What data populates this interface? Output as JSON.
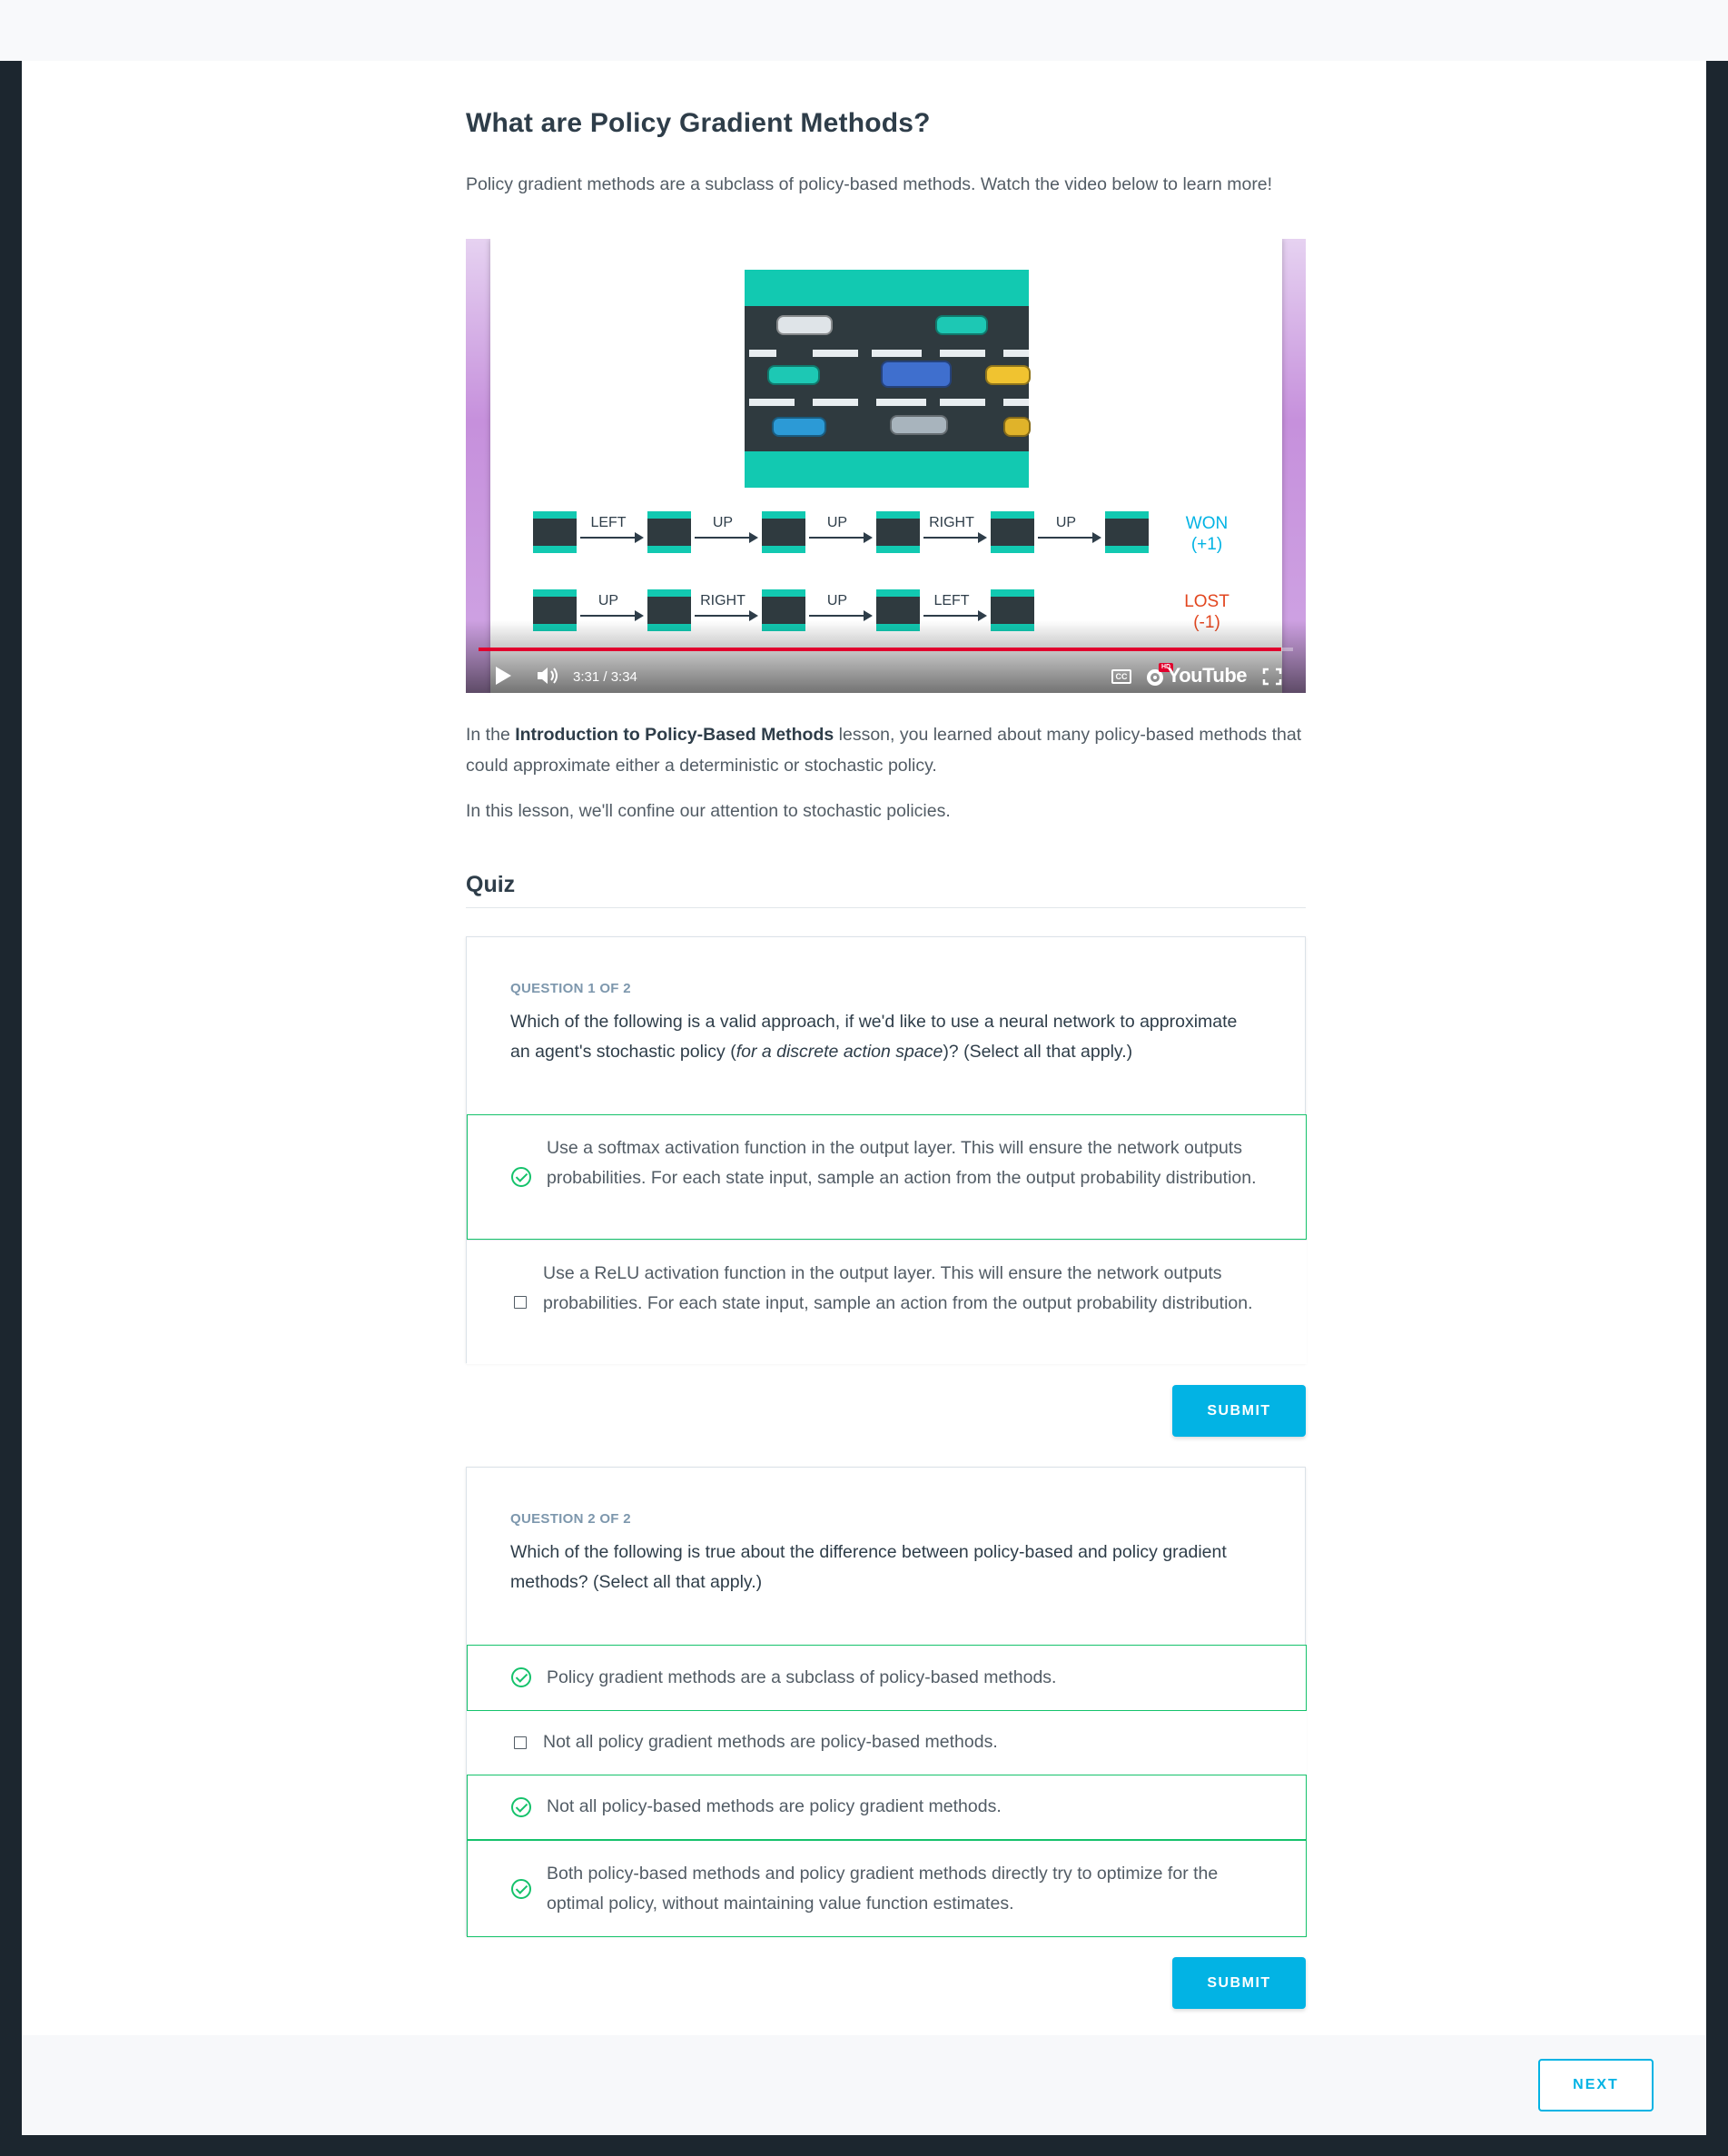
{
  "lesson": {
    "title": "What are Policy Gradient Methods?",
    "intro": "Policy gradient methods are a subclass of policy-based methods. Watch the video below to learn more!",
    "para2_prefix": "In the ",
    "para2_bold": "Introduction to Policy-Based Methods",
    "para2_suffix": " lesson, you learned about many policy-based methods that could approximate either a deterministic or stochastic policy.",
    "para3": "In this lesson, we'll confine our attention to stochastic policies."
  },
  "video": {
    "time": "3:31 / 3:34",
    "progress": 0.985,
    "brand": "YouTube",
    "cc_label": "CC",
    "hd_label": "HD",
    "row1": {
      "actions": [
        "LEFT",
        "UP",
        "UP",
        "RIGHT",
        "UP"
      ],
      "outcome": "WON",
      "reward": "(+1)"
    },
    "row2": {
      "actions": [
        "UP",
        "RIGHT",
        "UP",
        "LEFT"
      ],
      "outcome": "LOST",
      "reward": "(-1)"
    }
  },
  "quiz": {
    "heading": "Quiz",
    "q1": {
      "number": "QUESTION 1 OF 2",
      "text_a": "Which of the following is a valid approach, if we'd like to use a neural network to approximate an agent's stochastic policy (",
      "text_italic": "for a discrete action space",
      "text_b": ")? (Select all that apply.)",
      "options": [
        "Use a softmax activation function in the output layer. This will ensure the network outputs probabilities. For each state input, sample an action from the output probability distribution.",
        "Use a ReLU activation function in the output layer. This will ensure the network outputs probabilities. For each state input, sample an action from the output probability distribution."
      ],
      "submit": "SUBMIT"
    },
    "q2": {
      "number": "QUESTION 2 OF 2",
      "text": "Which of the following is true about the difference between policy-based and policy gradient methods? (Select all that apply.)",
      "options": [
        "Policy gradient methods are a subclass of policy-based methods.",
        "Not all policy gradient methods are policy-based methods.",
        "Not all policy-based methods are policy gradient methods.",
        "Both policy-based methods and policy gradient methods directly try to optimize for the optimal policy, without maintaining value function estimates."
      ],
      "submit": "SUBMIT"
    }
  },
  "footer": {
    "next": "NEXT"
  },
  "colors": {
    "accent": "#02b3e4",
    "success": "#15c26b",
    "lost": "#e2461f",
    "grass": "#12c9b1"
  }
}
